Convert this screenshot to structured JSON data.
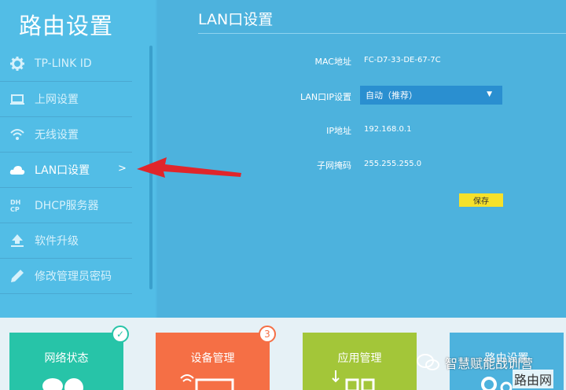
{
  "sidebar": {
    "title": "路由设置",
    "items": [
      {
        "label": "TP-LINK ID",
        "icon": "gear-icon"
      },
      {
        "label": "上网设置",
        "icon": "laptop-icon"
      },
      {
        "label": "无线设置",
        "icon": "wifi-icon"
      },
      {
        "label": "LAN口设置",
        "icon": "cloud-icon",
        "chevron": ">"
      },
      {
        "label": "DHCP服务器",
        "icon": "dhcp-icon"
      },
      {
        "label": "软件升级",
        "icon": "upload-icon"
      },
      {
        "label": "修改管理员密码",
        "icon": "pencil-icon"
      }
    ]
  },
  "main": {
    "title": "LAN口设置",
    "mac_label": "MAC地址",
    "mac_value": "FC-D7-33-DE-67-7C",
    "lanip_label": "LAN口IP设置",
    "lanip_value": "自动（推荐）",
    "ip_label": "IP地址",
    "ip_value": "192.168.0.1",
    "mask_label": "子网掩码",
    "mask_value": "255.255.255.0",
    "save_label": "保存"
  },
  "tiles": [
    {
      "label": "网络状态",
      "color": "#27c4a8",
      "badge": "✓"
    },
    {
      "label": "设备管理",
      "color": "#f56f45",
      "badge": "3"
    },
    {
      "label": "应用管理",
      "color": "#a3c639"
    },
    {
      "label": "路由设置",
      "color": "#4db2dd"
    }
  ],
  "watermark": {
    "text": "智慧赋能战训营",
    "text2": "路由网"
  },
  "colors": {
    "sidebar": "#52bde6",
    "main": "#4db2dd",
    "dropdown": "#2a8fd0",
    "save": "#f6e12a",
    "arrow": "#e0262b"
  }
}
